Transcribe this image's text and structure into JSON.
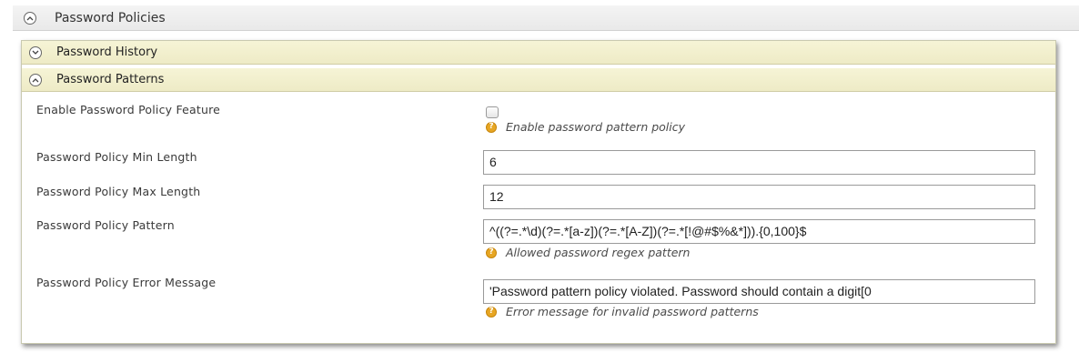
{
  "section": {
    "title": "Password Policies"
  },
  "panel": {
    "history_title": "Password History",
    "patterns_title": "Password Patterns"
  },
  "fields": {
    "enable": {
      "label": "Enable Password Policy Feature",
      "checked": false,
      "hint": "Enable password pattern policy"
    },
    "min_length": {
      "label": "Password Policy Min Length",
      "value": "6"
    },
    "max_length": {
      "label": "Password Policy Max Length",
      "value": "12"
    },
    "pattern": {
      "label": "Password Policy Pattern",
      "value": "^((?=.*\\d)(?=.*[a-z])(?=.*[A-Z])(?=.*[!@#$%&*])).{0,100}$",
      "hint": "Allowed password regex pattern"
    },
    "error_message": {
      "label": "Password Policy Error Message",
      "value": "'Password pattern policy violated. Password should contain a digit[0",
      "hint": "Error message for invalid password patterns"
    }
  },
  "icons": {
    "collapse": "chevron-up-icon",
    "expand": "chevron-down-icon",
    "help": "help-icon"
  },
  "help_glyph": "?",
  "colors": {
    "subheader_bg": "#f1eecb",
    "help_icon": "#e7a623"
  }
}
